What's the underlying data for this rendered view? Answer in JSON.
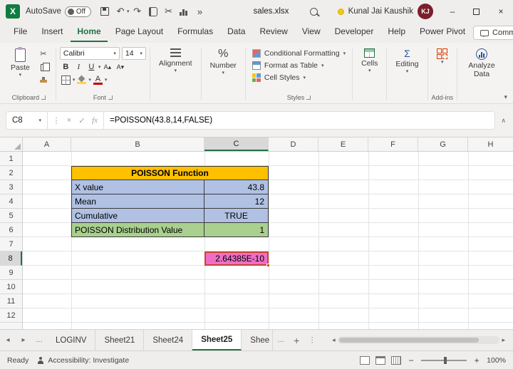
{
  "titlebar": {
    "logo_letter": "X",
    "autosave_label": "AutoSave",
    "autosave_state": "Off",
    "filename": "sales.xlsx",
    "user_name": "Kunal Jai Kaushik",
    "user_initials": "KJ"
  },
  "menubar": {
    "tabs": [
      "File",
      "Insert",
      "Home",
      "Page Layout",
      "Formulas",
      "Data",
      "Review",
      "View",
      "Developer",
      "Help",
      "Power Pivot"
    ],
    "comments_label": "Comments"
  },
  "ribbon": {
    "paste": "Paste",
    "clipboard_group": "Clipboard",
    "font_name": "Calibri",
    "font_size": "14",
    "font_group": "Font",
    "alignment": "Alignment",
    "number": "Number",
    "conditional_formatting": "Conditional Formatting",
    "format_as_table": "Format as Table",
    "cell_styles": "Cell Styles",
    "styles_group": "Styles",
    "cells": "Cells",
    "editing": "Editing",
    "addins": "Add-ins",
    "analyze_data": "Analyze Data"
  },
  "formula_bar": {
    "cell_ref": "C8",
    "fx": "fx",
    "formula": "=POISSON(43.8,14,FALSE)"
  },
  "grid": {
    "cols": [
      "A",
      "B",
      "C",
      "D",
      "E",
      "F",
      "G",
      "H"
    ],
    "rows": [
      "1",
      "2",
      "3",
      "4",
      "5",
      "6",
      "7",
      "8",
      "9",
      "10",
      "11",
      "12"
    ]
  },
  "table": {
    "title": "POISSON Function",
    "rows": [
      {
        "label": "X value",
        "value": "43.8"
      },
      {
        "label": "Mean",
        "value": "12"
      },
      {
        "label": "Cumulative",
        "value": "TRUE"
      },
      {
        "label": "POISSON Distribution Value",
        "value": "1"
      }
    ],
    "result": "2.64385E-10"
  },
  "sheetbar": {
    "tabs": [
      "LOGINV",
      "Sheet21",
      "Sheet24",
      "Sheet25",
      "Shee"
    ],
    "active_tab": "Sheet25"
  },
  "statusbar": {
    "ready": "Ready",
    "accessibility": "Accessibility: Investigate",
    "zoom": "100%"
  },
  "colors": {
    "excel_green": "#217346",
    "table_header_fill": "#FFC000",
    "table_row_fill": "#B1C1E4",
    "table_result_fill": "#A9D08E",
    "cell_c8_fill": "#EE6EC7",
    "selection_border": "#C84528"
  },
  "icons": {
    "caret": "▾",
    "undo": "↶",
    "redo": "↷",
    "cut": "✂",
    "more": "»",
    "minimize": "–",
    "close": "×",
    "cancel": "×",
    "check": "✓",
    "percent": "%",
    "sigma": "Σ",
    "bold": "B",
    "italic": "I",
    "underline": "U",
    "font_color_letter": "A",
    "grow_font": "A▴",
    "shrink_font": "A▾",
    "nav_left": "◂",
    "nav_right": "▸",
    "dots": "…",
    "kebab": "⋮",
    "plus": "+",
    "minus": "−",
    "collapse": "∧"
  }
}
